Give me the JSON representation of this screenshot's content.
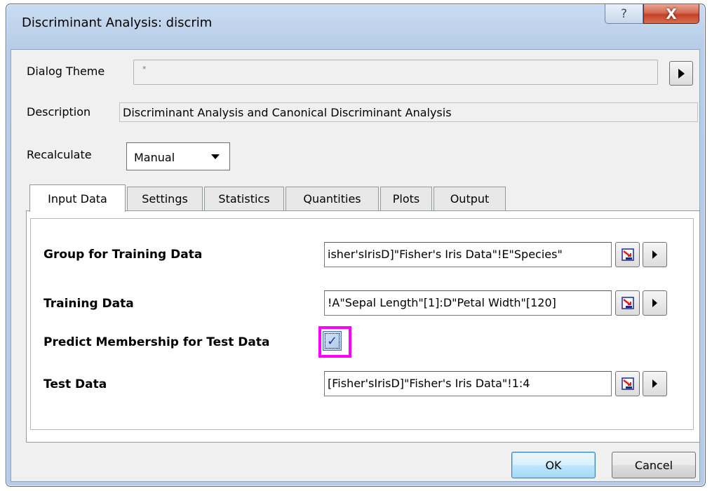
{
  "window": {
    "title": "Discriminant Analysis: discrim",
    "help_glyph": "?",
    "close_glyph": "X"
  },
  "header": {
    "dialog_theme_label": "Dialog Theme",
    "dialog_theme_value": "*",
    "description_label": "Description",
    "description_value": "Discriminant Analysis and Canonical Discriminant Analysis",
    "recalculate_label": "Recalculate",
    "recalculate_value": "Manual"
  },
  "tabs": [
    {
      "label": "Input Data"
    },
    {
      "label": "Settings"
    },
    {
      "label": "Statistics"
    },
    {
      "label": "Quantities"
    },
    {
      "label": "Plots"
    },
    {
      "label": "Output"
    }
  ],
  "input_data": {
    "group_label": "Group for Training Data",
    "group_value": "isher'sIrisD]\"Fisher's Iris Data\"!E\"Species\"",
    "training_label": "Training Data",
    "training_value": "!A\"Sepal Length\"[1]:D\"Petal Width\"[120]",
    "predict_label": "Predict Membership for Test Data",
    "predict_checked": true,
    "predict_check_glyph": "✓",
    "test_label": "Test Data",
    "test_value": "[Fisher'sIrisD]\"Fisher's Iris Data\"!1:4"
  },
  "buttons": {
    "ok": "OK",
    "cancel": "Cancel"
  },
  "colors": {
    "highlight": "#ff00ff",
    "title_bar": "#c9dcf1",
    "close_button": "#c3412a"
  }
}
